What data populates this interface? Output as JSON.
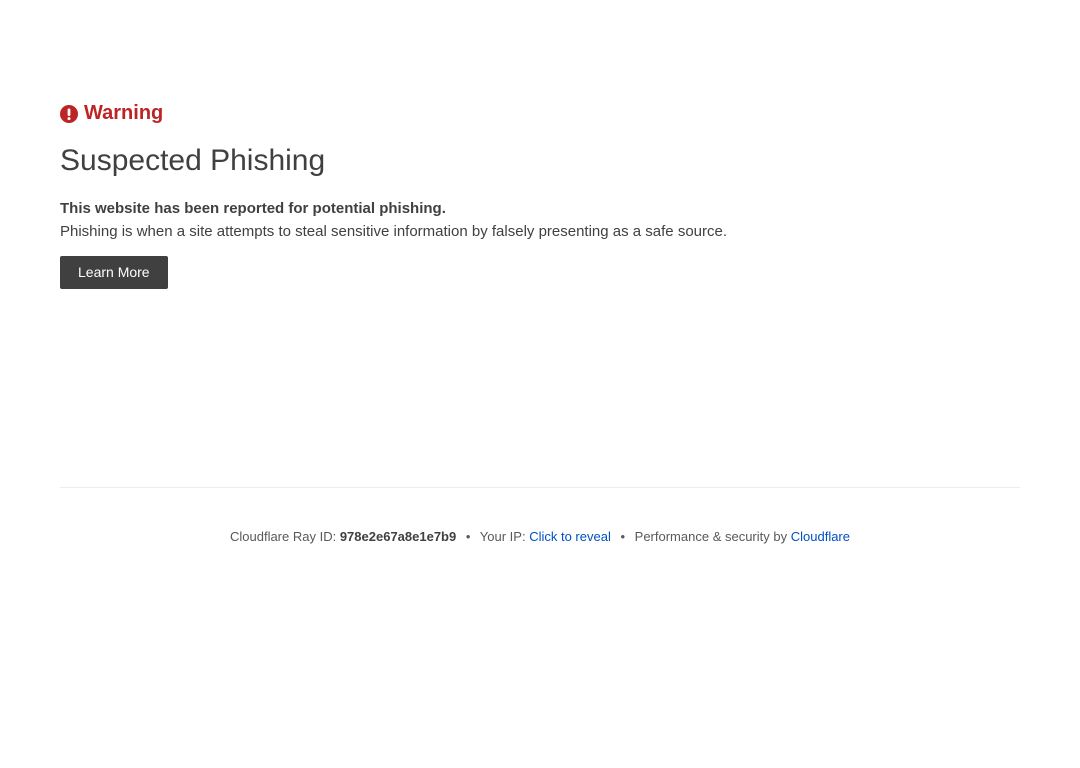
{
  "warning": {
    "label": "Warning",
    "icon": "exclamation-circle-icon",
    "color": "#bd2426"
  },
  "main": {
    "title": "Suspected Phishing",
    "strong_text": "This website has been reported for potential phishing.",
    "description": "Phishing is when a site attempts to steal sensitive information by falsely presenting as a safe source.",
    "learn_more_label": "Learn More"
  },
  "footer": {
    "ray_id_label": "Cloudflare Ray ID:",
    "ray_id_value": "978e2e67a8e1e7b9",
    "separator": "•",
    "ip_label": "Your IP:",
    "ip_link": "Click to reveal",
    "perf_label": "Performance & security by",
    "perf_link": "Cloudflare",
    "link_color": "#0051c3"
  }
}
